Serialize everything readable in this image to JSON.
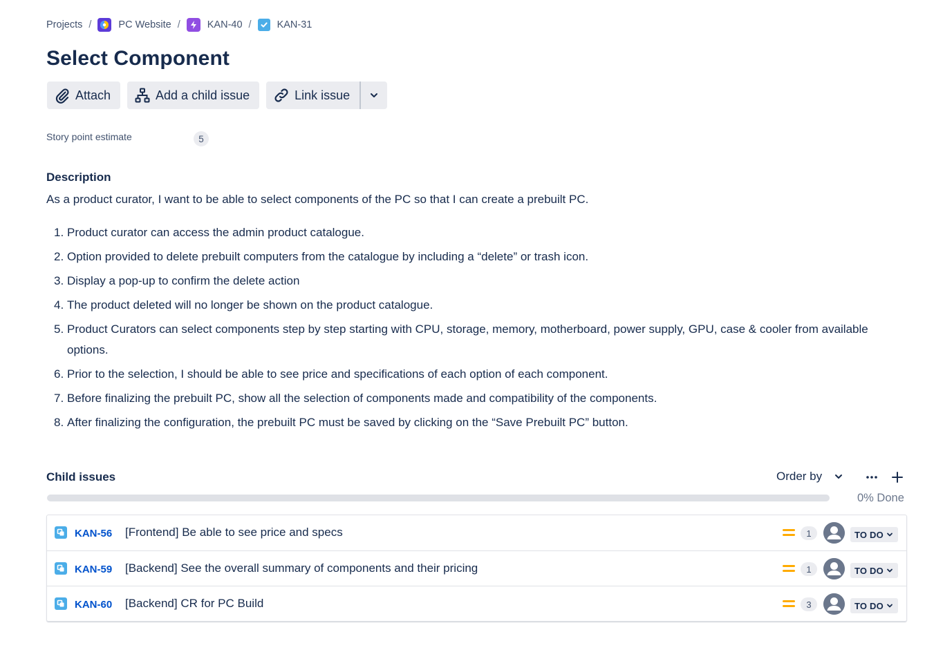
{
  "breadcrumb": {
    "items": [
      {
        "label": "Projects",
        "icon": null
      },
      {
        "label": "PC Website",
        "icon": "project-icon"
      },
      {
        "label": "KAN-40",
        "icon": "epic-icon"
      },
      {
        "label": "KAN-31",
        "icon": "task-icon"
      }
    ],
    "separator": "/"
  },
  "issue": {
    "title": "Select Component"
  },
  "toolbar": {
    "attach_label": "Attach",
    "add_child_label": "Add a child issue",
    "link_issue_label": "Link issue"
  },
  "fields": {
    "story_point_label": "Story point estimate",
    "story_point_value": "5"
  },
  "description": {
    "heading": "Description",
    "intro": "As a product curator, I want to be able to select components of the PC so that I can create a prebuilt PC.",
    "items": [
      {
        "num": "1.",
        "text": "Product curator can access the admin product catalogue."
      },
      {
        "num": "2.",
        "text": "Option provided to delete prebuilt computers from the catalogue by including a “delete” or trash icon."
      },
      {
        "num": "3.",
        "text": "Display a pop-up to confirm the delete action"
      },
      {
        "num": "4.",
        "text": "The product deleted will no longer be shown on the product catalogue."
      },
      {
        "num": "5.",
        "text": "Product Curators can select components step by step starting with CPU, storage, memory, motherboard, power supply, GPU, case & cooler from available options."
      },
      {
        "num": "6.",
        "text": "Prior to the selection, I should be able to see price and specifications of each option of each component."
      },
      {
        "num": "7.",
        "text": "Before finalizing the prebuilt PC, show all the selection of components made and compatibility of the components."
      },
      {
        "num": "8.",
        "text": "After finalizing the configuration, the prebuilt PC must be saved by clicking on the “Save Prebuilt PC” button."
      }
    ]
  },
  "child_issues": {
    "heading": "Child issues",
    "order_by_label": "Order by",
    "progress_percent": 0,
    "progress_text": "0% Done",
    "rows": [
      {
        "key": "KAN-56",
        "summary": "[Frontend] Be able to see price and specs",
        "points": "1",
        "status": "TO DO",
        "priority": "medium"
      },
      {
        "key": "KAN-59",
        "summary": "[Backend] See the overall summary of components and their pricing",
        "points": "1",
        "status": "TO DO",
        "priority": "medium"
      },
      {
        "key": "KAN-60",
        "summary": "[Backend] CR for PC Build",
        "points": "3",
        "status": "TO DO",
        "priority": "medium"
      }
    ]
  },
  "colors": {
    "link": "#0052cc",
    "text": "#172b4d",
    "button_bg": "#ebecf0",
    "priority_medium": "#ffab00",
    "subtask": "#4bade8",
    "epic": "#904ee2"
  }
}
